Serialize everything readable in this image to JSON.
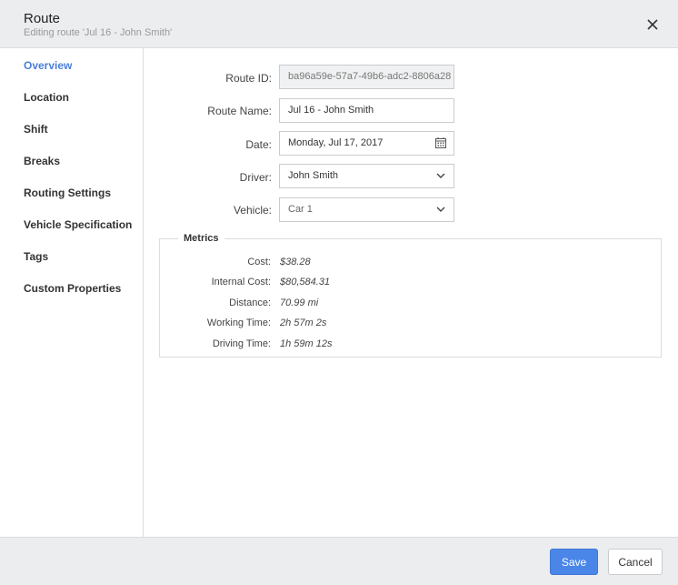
{
  "header": {
    "title": "Route",
    "subtitle": "Editing route 'Jul 16 - John Smith'"
  },
  "sidebar": {
    "items": [
      {
        "label": "Overview",
        "active": true
      },
      {
        "label": "Location"
      },
      {
        "label": "Shift"
      },
      {
        "label": "Breaks"
      },
      {
        "label": "Routing Settings"
      },
      {
        "label": "Vehicle Specification"
      },
      {
        "label": "Tags"
      },
      {
        "label": "Custom Properties"
      }
    ]
  },
  "form": {
    "route_id": {
      "label": "Route ID:",
      "value": "ba96a59e-57a7-49b6-adc2-8806a28"
    },
    "route_name": {
      "label": "Route Name:",
      "value": "Jul 16 - John Smith"
    },
    "date": {
      "label": "Date:",
      "value": "Monday, Jul 17, 2017"
    },
    "driver": {
      "label": "Driver:",
      "value": "John Smith"
    },
    "vehicle": {
      "label": "Vehicle:",
      "value": "Car 1"
    }
  },
  "metrics": {
    "title": "Metrics",
    "rows": [
      {
        "label": "Cost:",
        "value": "$38.28"
      },
      {
        "label": "Internal Cost:",
        "value": "$80,584.31"
      },
      {
        "label": "Distance:",
        "value": "70.99 mi"
      },
      {
        "label": "Working Time:",
        "value": "2h 57m 2s"
      },
      {
        "label": "Driving Time:",
        "value": "1h 59m 12s"
      }
    ]
  },
  "footer": {
    "save_label": "Save",
    "cancel_label": "Cancel"
  },
  "colors": {
    "accent": "#4a86e8",
    "active_nav": "#4a7fd9",
    "header_bg": "#ecedef"
  }
}
